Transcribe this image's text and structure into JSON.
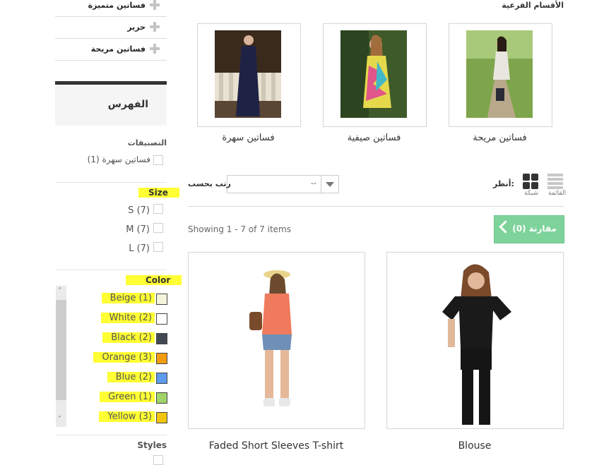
{
  "sidebar": {
    "categories": [
      {
        "label": "فساتين متميزة"
      },
      {
        "label": "حرير"
      },
      {
        "label": "فساتين مريحة"
      }
    ],
    "filter_title": "الفهرس",
    "groups": {
      "categories": {
        "title": "التصنيفات",
        "options": [
          {
            "label": "فساتين سهرة (1)"
          }
        ]
      },
      "size": {
        "title": "Size",
        "options": [
          {
            "label": "S",
            "count": "(7)"
          },
          {
            "label": "M",
            "count": "(7)"
          },
          {
            "label": "L",
            "count": "(7)"
          }
        ]
      },
      "color": {
        "title": "Color",
        "options": [
          {
            "label": "Beige",
            "count": "(1)",
            "color": "#f5f5dc"
          },
          {
            "label": "White",
            "count": "(2)",
            "color": "#ffffff"
          },
          {
            "label": "Black",
            "count": "(2)",
            "color": "#434a54"
          },
          {
            "label": "Orange",
            "count": "(3)",
            "color": "#f39c11"
          },
          {
            "label": "Blue",
            "count": "(2)",
            "color": "#5d9cec"
          },
          {
            "label": "Green",
            "count": "(1)",
            "color": "#a0d468"
          },
          {
            "label": "Yellow",
            "count": "(3)",
            "color": "#f1c40f"
          }
        ]
      },
      "styles": {
        "title": "Styles"
      }
    },
    "scroll_up": "˄",
    "scroll_down": "˅"
  },
  "main": {
    "subcategories_title": "الأقسام الفرعية",
    "subcategories": [
      {
        "name": "فساتين سهرة"
      },
      {
        "name": "فساتين صيفية"
      },
      {
        "name": "فساتين مريحة"
      }
    ],
    "view_label": "أنظر:",
    "view_grid": "شبكة",
    "view_list": "القائمة",
    "sort_label": "رتب بحسب",
    "sort_value": "--",
    "showing": "Showing 1 - 7 of 7 items",
    "compare_label": "مقارنة (0)",
    "products": [
      {
        "name": "Faded Short Sleeves T-shirt"
      },
      {
        "name": "Blouse"
      }
    ]
  },
  "colors": {
    "highlight": "#ffff33",
    "compare_green": "#7dd39a"
  }
}
